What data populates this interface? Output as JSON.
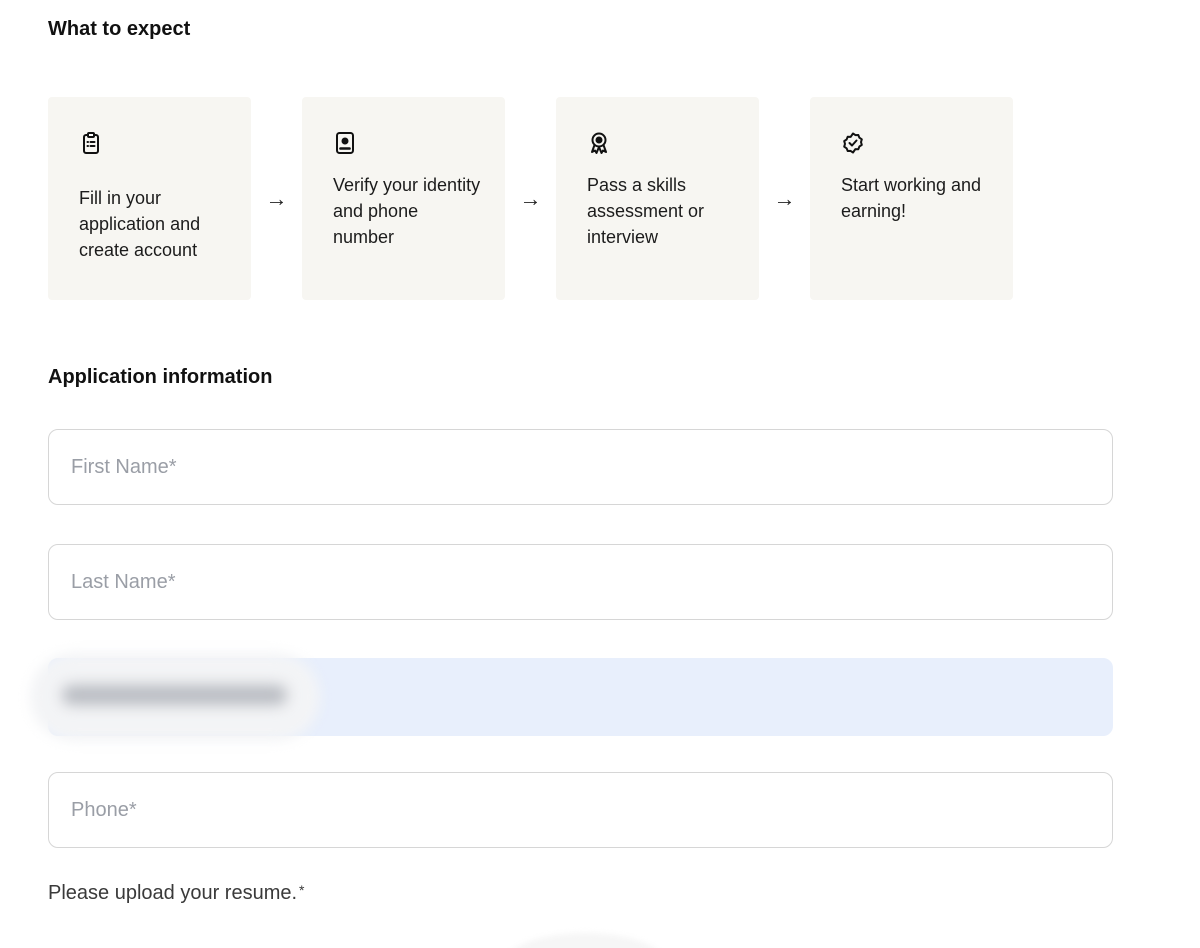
{
  "expect": {
    "title": "What to expect",
    "steps": [
      {
        "icon": "clipboard-icon",
        "text": "Fill in your application and create account"
      },
      {
        "icon": "id-badge-icon",
        "text": "Verify your identity and phone number"
      },
      {
        "icon": "award-icon",
        "text": "Pass a skills assessment or interview"
      },
      {
        "icon": "check-circle-icon",
        "text": "Start working and earning!"
      }
    ],
    "arrow": "→"
  },
  "application": {
    "title": "Application information",
    "first_name_placeholder": "First Name*",
    "last_name_placeholder": "Last Name*",
    "email_value": "",
    "phone_placeholder": "Phone*",
    "upload_label": "Please upload your resume.",
    "upload_required_mark": "*"
  },
  "colors": {
    "card_background": "#f7f6f2",
    "autofill_background": "#e8effc",
    "field_border": "#d6d6d6",
    "placeholder": "#9a9ea6"
  }
}
